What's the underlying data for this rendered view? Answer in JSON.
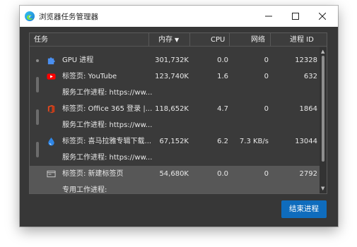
{
  "window": {
    "title": "浏览器任务管理器"
  },
  "columns": {
    "task": "任务",
    "memory": "内存",
    "cpu": "CPU",
    "network": "网络",
    "pid": "进程 ID"
  },
  "rows": [
    {
      "task": "GPU 进程",
      "memory": "301,732K",
      "cpu": "0.0",
      "network": "0",
      "pid": "12328",
      "icon": "puzzle-icon"
    },
    {
      "task": "标签页: YouTube",
      "memory": "123,740K",
      "cpu": "1.6",
      "network": "0",
      "pid": "632",
      "icon": "youtube-icon"
    },
    {
      "task": "服务工作进程: https://ww...",
      "memory": "",
      "cpu": "",
      "network": "",
      "pid": ""
    },
    {
      "task": "标签页: Office 365 登录 |...",
      "memory": "118,652K",
      "cpu": "4.7",
      "network": "0",
      "pid": "1864",
      "icon": "office-icon"
    },
    {
      "task": "服务工作进程: https://ww...",
      "memory": "",
      "cpu": "",
      "network": "",
      "pid": ""
    },
    {
      "task": "标签页: 喜马拉雅专辑下载...",
      "memory": "67,152K",
      "cpu": "6.2",
      "network": "7.3 KB/s",
      "pid": "13044",
      "icon": "water-drop-icon"
    },
    {
      "task": "服务工作进程: https://ww...",
      "memory": "",
      "cpu": "",
      "network": "",
      "pid": ""
    },
    {
      "task": "标签页: 新建标签页",
      "memory": "54,680K",
      "cpu": "0.0",
      "network": "0",
      "pid": "2792",
      "icon": "new-tab-icon"
    },
    {
      "task": "专用工作进程:",
      "memory": "",
      "cpu": "",
      "network": "",
      "pid": ""
    }
  ],
  "selected_row_index": 7,
  "actions": {
    "end_process": "结束进程"
  },
  "colors": {
    "accent": "#0f6cbd",
    "background": "#373737",
    "selected_row": "#575757"
  }
}
